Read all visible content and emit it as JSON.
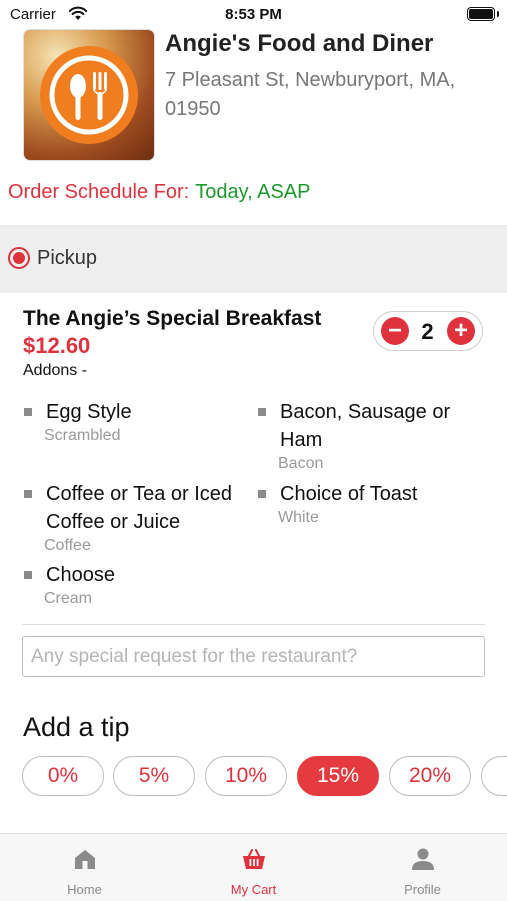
{
  "status_bar": {
    "carrier": "Carrier",
    "time": "8:53 PM"
  },
  "restaurant": {
    "name": "Angie's Food and Diner",
    "address": "7 Pleasant St, Newburyport, MA, 01950",
    "logo": "fork-spoon-logo-icon"
  },
  "schedule": {
    "label": "Order Schedule For:",
    "value": "Today, ASAP"
  },
  "order_type": {
    "label": "Pickup",
    "selected": true
  },
  "item": {
    "name": "The Angie’s Special Breakfast",
    "price": "$12.60",
    "addons_label": "Addons -",
    "quantity": "2",
    "minus_symbol": "−",
    "plus_symbol": "+",
    "addons": [
      {
        "name": "Egg Style",
        "value": "Scrambled"
      },
      {
        "name": "Bacon, Sausage or Ham",
        "value": "Bacon"
      },
      {
        "name": "Coffee or Tea or Iced Coffee or Juice",
        "value": "Coffee"
      },
      {
        "name": "Choice of Toast",
        "value": "White"
      },
      {
        "name": "Choose",
        "value": "Cream"
      }
    ]
  },
  "special_request": {
    "placeholder": "Any special request for the restaurant?",
    "value": ""
  },
  "tip": {
    "title": "Add a tip",
    "options": [
      "0%",
      "5%",
      "10%",
      "15%",
      "20%"
    ],
    "selected": "15%"
  },
  "tabbar": {
    "tabs": [
      {
        "label": "Home",
        "icon": "home-icon"
      },
      {
        "label": "My Cart",
        "icon": "cart-basket-icon",
        "active": true
      },
      {
        "label": "Profile",
        "icon": "profile-icon"
      }
    ]
  },
  "colors": {
    "accent": "#e0323c",
    "schedule_value": "#1a9a2a",
    "logo_orange": "#f07e1e"
  }
}
